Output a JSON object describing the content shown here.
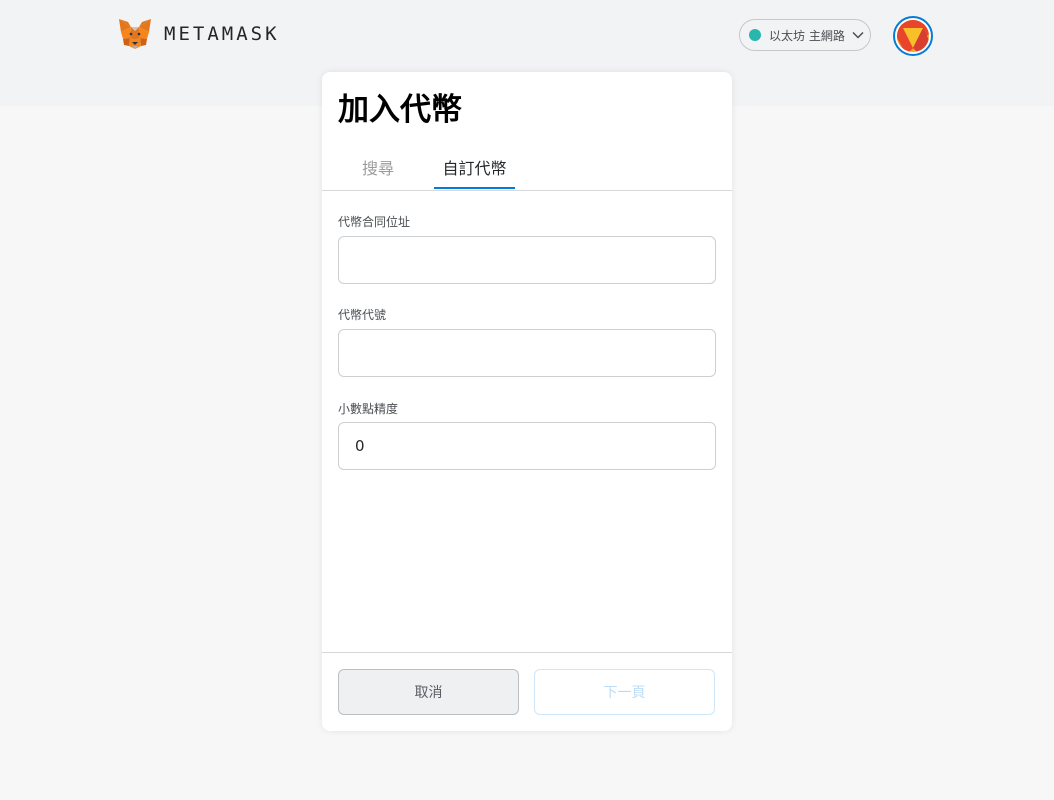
{
  "header": {
    "brand_name": "METAMASK",
    "logo_icon": "metamask-fox-icon",
    "network": {
      "label": "以太坊 主網路",
      "status_color": "#29b6af",
      "chevron_icon": "chevron-down-icon"
    },
    "account_avatar_icon": "account-identicon"
  },
  "page": {
    "title": "加入代幣",
    "tabs": [
      {
        "label": "搜尋",
        "active": false
      },
      {
        "label": "自訂代幣",
        "active": true
      }
    ],
    "form": {
      "contract_address": {
        "label": "代幣合同位址",
        "value": "",
        "placeholder": ""
      },
      "token_symbol": {
        "label": "代幣代號",
        "value": "",
        "placeholder": ""
      },
      "decimals": {
        "label": "小數點精度",
        "value": "0",
        "placeholder": ""
      }
    },
    "footer": {
      "cancel_label": "取消",
      "next_label": "下一頁",
      "next_disabled": true
    }
  },
  "colors": {
    "accent": "#037dd6",
    "network_dot": "#29b6af",
    "background": "#f7f7f7",
    "header_band": "#f2f3f4"
  }
}
